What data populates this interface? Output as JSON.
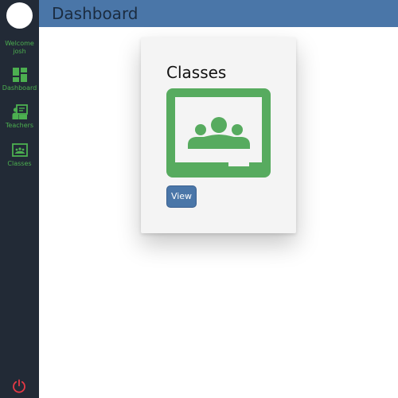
{
  "header": {
    "title": "Dashboard"
  },
  "sidebar": {
    "welcome": "Welcome josh",
    "items": [
      {
        "label": "Dashboard",
        "icon": "dashboard-icon"
      },
      {
        "label": "Teachers",
        "icon": "teacher-icon"
      },
      {
        "label": "Classes",
        "icon": "classroom-icon"
      }
    ],
    "logout_icon": "power-icon"
  },
  "card": {
    "title": "Classes",
    "icon": "google-classroom-icon",
    "button_label": "View"
  },
  "colors": {
    "sidebar_bg": "#222a36",
    "accent_green": "#4caf50",
    "header_blue": "#4a76a8",
    "power_red": "#e53945",
    "card_bg": "#f4f4f4"
  }
}
